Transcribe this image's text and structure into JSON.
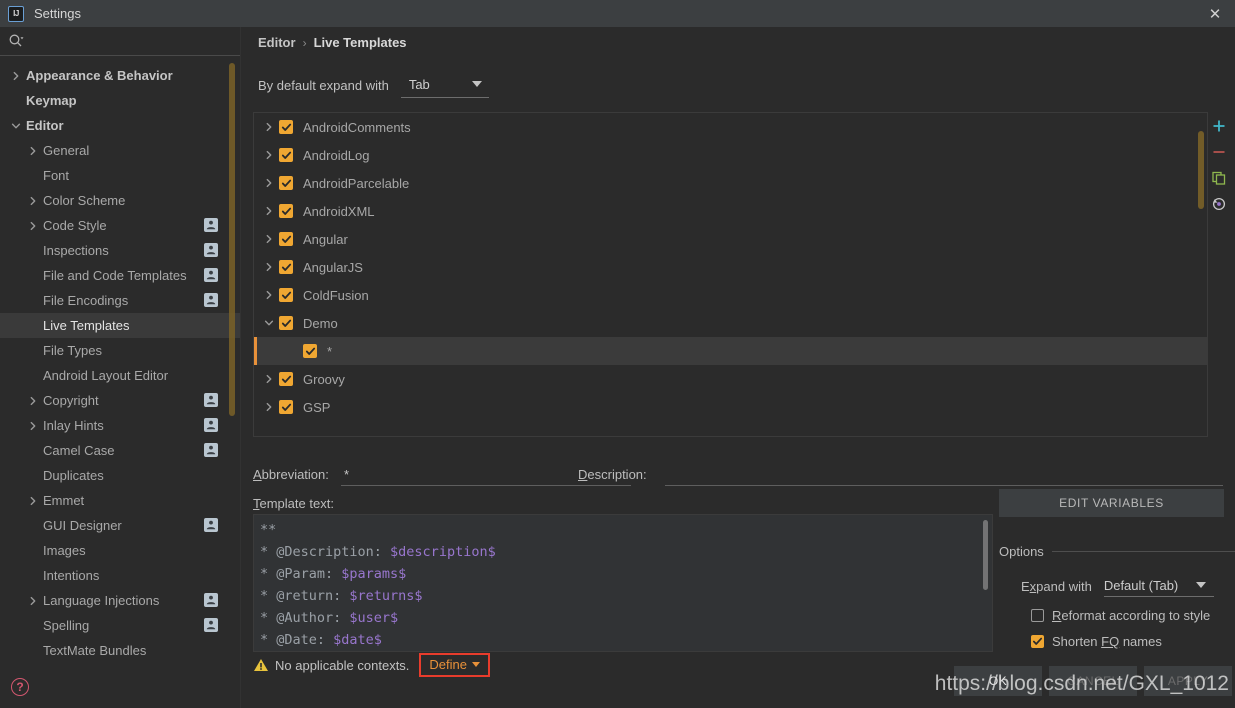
{
  "window": {
    "title": "Settings",
    "logo_text": "IJ",
    "close_icon": "close-icon"
  },
  "sidebar": {
    "search": {
      "value": "",
      "placeholder": "",
      "icon": "search-icon"
    },
    "help_icon": "help-icon",
    "help_label": "?",
    "items": [
      {
        "label": "Appearance & Behavior",
        "arrow": "right",
        "indent": 0,
        "badge": false,
        "selected": false,
        "bold": true
      },
      {
        "label": "Keymap",
        "arrow": "none",
        "indent": 0,
        "badge": false,
        "selected": false,
        "bold": true
      },
      {
        "label": "Editor",
        "arrow": "down",
        "indent": 0,
        "badge": false,
        "selected": false,
        "bold": true
      },
      {
        "label": "General",
        "arrow": "right",
        "indent": 1,
        "badge": false,
        "selected": false,
        "bold": false
      },
      {
        "label": "Font",
        "arrow": "none",
        "indent": 1,
        "badge": false,
        "selected": false,
        "bold": false
      },
      {
        "label": "Color Scheme",
        "arrow": "right",
        "indent": 1,
        "badge": false,
        "selected": false,
        "bold": false
      },
      {
        "label": "Code Style",
        "arrow": "right",
        "indent": 1,
        "badge": true,
        "selected": false,
        "bold": false
      },
      {
        "label": "Inspections",
        "arrow": "none",
        "indent": 1,
        "badge": true,
        "selected": false,
        "bold": false
      },
      {
        "label": "File and Code Templates",
        "arrow": "none",
        "indent": 1,
        "badge": true,
        "selected": false,
        "bold": false
      },
      {
        "label": "File Encodings",
        "arrow": "none",
        "indent": 1,
        "badge": true,
        "selected": false,
        "bold": false
      },
      {
        "label": "Live Templates",
        "arrow": "none",
        "indent": 1,
        "badge": false,
        "selected": true,
        "bold": false
      },
      {
        "label": "File Types",
        "arrow": "none",
        "indent": 1,
        "badge": false,
        "selected": false,
        "bold": false
      },
      {
        "label": "Android Layout Editor",
        "arrow": "none",
        "indent": 1,
        "badge": false,
        "selected": false,
        "bold": false
      },
      {
        "label": "Copyright",
        "arrow": "right",
        "indent": 1,
        "badge": true,
        "selected": false,
        "bold": false
      },
      {
        "label": "Inlay Hints",
        "arrow": "right",
        "indent": 1,
        "badge": true,
        "selected": false,
        "bold": false
      },
      {
        "label": "Camel Case",
        "arrow": "none",
        "indent": 1,
        "badge": true,
        "selected": false,
        "bold": false
      },
      {
        "label": "Duplicates",
        "arrow": "none",
        "indent": 1,
        "badge": false,
        "selected": false,
        "bold": false
      },
      {
        "label": "Emmet",
        "arrow": "right",
        "indent": 1,
        "badge": false,
        "selected": false,
        "bold": false
      },
      {
        "label": "GUI Designer",
        "arrow": "none",
        "indent": 1,
        "badge": true,
        "selected": false,
        "bold": false
      },
      {
        "label": "Images",
        "arrow": "none",
        "indent": 1,
        "badge": false,
        "selected": false,
        "bold": false
      },
      {
        "label": "Intentions",
        "arrow": "none",
        "indent": 1,
        "badge": false,
        "selected": false,
        "bold": false
      },
      {
        "label": "Language Injections",
        "arrow": "right",
        "indent": 1,
        "badge": true,
        "selected": false,
        "bold": false
      },
      {
        "label": "Spelling",
        "arrow": "none",
        "indent": 1,
        "badge": true,
        "selected": false,
        "bold": false
      },
      {
        "label": "TextMate Bundles",
        "arrow": "none",
        "indent": 1,
        "badge": false,
        "selected": false,
        "bold": false
      }
    ]
  },
  "main": {
    "breadcrumb": {
      "parent": "Editor",
      "separator": "›",
      "current": "Live Templates"
    },
    "expand_with": {
      "label": "By default expand with",
      "value": "Tab"
    },
    "templates": [
      {
        "label": "AndroidComments",
        "arrow": "right",
        "checked": true,
        "indent": 0,
        "selected": false
      },
      {
        "label": "AndroidLog",
        "arrow": "right",
        "checked": true,
        "indent": 0,
        "selected": false
      },
      {
        "label": "AndroidParcelable",
        "arrow": "right",
        "checked": true,
        "indent": 0,
        "selected": false
      },
      {
        "label": "AndroidXML",
        "arrow": "right",
        "checked": true,
        "indent": 0,
        "selected": false
      },
      {
        "label": "Angular",
        "arrow": "right",
        "checked": true,
        "indent": 0,
        "selected": false
      },
      {
        "label": "AngularJS",
        "arrow": "right",
        "checked": true,
        "indent": 0,
        "selected": false
      },
      {
        "label": "ColdFusion",
        "arrow": "right",
        "checked": true,
        "indent": 0,
        "selected": false
      },
      {
        "label": "Demo",
        "arrow": "down",
        "checked": true,
        "indent": 0,
        "selected": false
      },
      {
        "label": "*",
        "arrow": "none",
        "checked": true,
        "indent": 1,
        "selected": true
      },
      {
        "label": "Groovy",
        "arrow": "right",
        "checked": true,
        "indent": 0,
        "selected": false
      },
      {
        "label": "GSP",
        "arrow": "right",
        "checked": true,
        "indent": 0,
        "selected": false
      }
    ],
    "toolbar": [
      {
        "name": "add-icon",
        "glyph": "+"
      },
      {
        "name": "remove-icon",
        "glyph": "−"
      },
      {
        "name": "copy-icon",
        "glyph": "copy"
      },
      {
        "name": "revert-icon",
        "glyph": "revert"
      }
    ],
    "abbreviation": {
      "label": "Abbreviation:",
      "mnemonic": "A",
      "value": "*"
    },
    "description": {
      "label": "Description:",
      "mnemonic": "D",
      "value": ""
    },
    "template_text": {
      "label": "Template text:",
      "mnemonic": "T",
      "lines": [
        {
          "prefix": "**",
          "var": ""
        },
        {
          "prefix": "* @Description: ",
          "var": "$description$"
        },
        {
          "prefix": "* @Param: ",
          "var": "$params$"
        },
        {
          "prefix": "* @return: ",
          "var": "$returns$"
        },
        {
          "prefix": "* @Author: ",
          "var": "$user$"
        },
        {
          "prefix": "* @Date: ",
          "var": "$date$"
        }
      ]
    },
    "warning": {
      "icon": "warning-icon",
      "text": "No applicable contexts.",
      "action": "Define"
    }
  },
  "options": {
    "edit_variables_label": "EDIT VARIABLES",
    "edit_variables_mnemonic": "E",
    "title": "Options",
    "expand_with": {
      "label": "Expand with",
      "mnemonic": "x",
      "value": "Default (Tab)"
    },
    "checks": [
      {
        "label": "Reformat according to style",
        "mnemonic": "R",
        "checked": false
      },
      {
        "label": "Shorten FQ names",
        "mnemonic": "FQ",
        "checked": true
      }
    ]
  },
  "buttons": {
    "ok": "OK",
    "cancel": "CANCEL",
    "apply": "APPLY"
  },
  "watermark": "https://blog.csdn.net/GXL_1012",
  "colors": {
    "accent_orange": "#f0a732",
    "selection_bar": "#e8913a",
    "warning_yellow": "#e8c33c",
    "annotation_red": "#e83c2c",
    "variable_purple": "#9876cd",
    "background": "#2b2b2b",
    "panel": "#3c3f41"
  }
}
